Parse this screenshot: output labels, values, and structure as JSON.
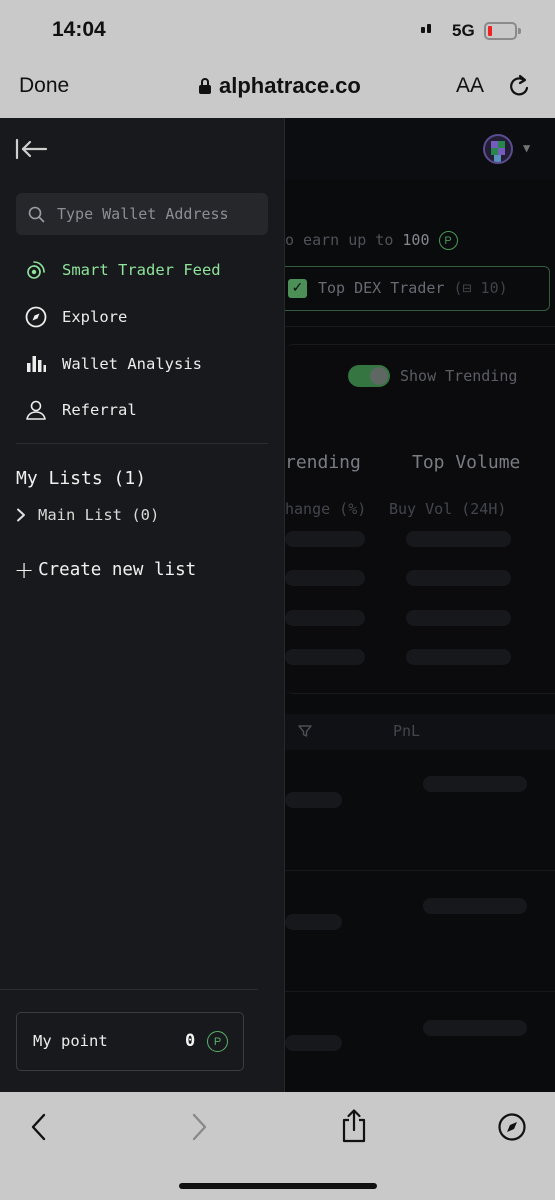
{
  "status_bar": {
    "time": "14:04",
    "network": "5G",
    "battery_level": 0.1
  },
  "safari": {
    "done_label": "Done",
    "url": "alphatrace.co",
    "text_size_label": "AA"
  },
  "drawer": {
    "search": {
      "placeholder": "Type Wallet Address"
    },
    "nav": [
      {
        "label": "Smart Trader Feed",
        "icon": "radar-icon",
        "active": true
      },
      {
        "label": "Explore",
        "icon": "compass-icon",
        "active": false
      },
      {
        "label": "Wallet Analysis",
        "icon": "bar-chart-icon",
        "active": false
      },
      {
        "label": "Referral",
        "icon": "user-icon",
        "active": false
      }
    ],
    "lists": {
      "title": "My Lists (1)",
      "items": [
        {
          "label": "Main List (0)"
        }
      ],
      "create_label": "Create new list"
    },
    "points": {
      "label": "My point",
      "value": "0",
      "badge": "P"
    }
  },
  "background": {
    "earn_text_prefix": "o earn up to ",
    "earn_amount": "100",
    "earn_badge": "P",
    "filter_label": "Top DEX Trader",
    "filter_count": "(⊟ 10)",
    "show_trending_label": "Show Trending",
    "col_trending": "rending",
    "col_top_volume": "Top Volume",
    "sub_change": "hange (%)",
    "sub_buy_vol": "Buy Vol (24H)",
    "table_pnl_header": "PnL"
  },
  "colors": {
    "accent_green": "#8fe39b",
    "drawer_bg": "#18191c",
    "app_bg": "#0c0d10"
  }
}
